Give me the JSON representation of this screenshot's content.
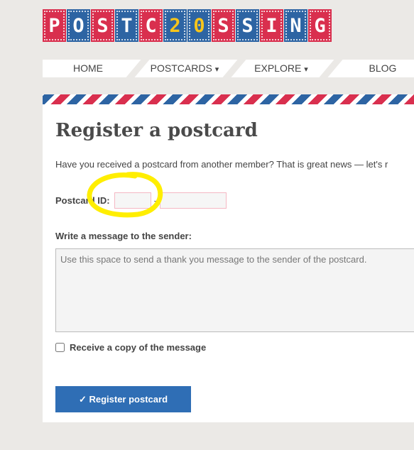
{
  "logo": {
    "letters": [
      "P",
      "O",
      "S",
      "T",
      "C",
      "2",
      "0",
      "S",
      "S",
      "I",
      "N",
      "G"
    ]
  },
  "nav": {
    "items": [
      {
        "label": "HOME"
      },
      {
        "label": "POSTCARDS",
        "caret": "▾"
      },
      {
        "label": "EXPLORE",
        "caret": "▾"
      },
      {
        "label": "BLOG"
      }
    ]
  },
  "page": {
    "title": "Register a postcard",
    "intro": "Have you received a postcard from another member? That is great news — let's r"
  },
  "form": {
    "postcard_id_label": "Postcard ID:",
    "id_separator": "-",
    "id_part1_value": "",
    "id_part2_value": "",
    "message_label": "Write a message to the sender:",
    "message_placeholder": "Use this space to send a thank you message to the sender of the postcard.",
    "copy_label": "Receive a copy of the message",
    "copy_checked": false,
    "submit_label": "✓ Register postcard"
  },
  "colors": {
    "red": "#d92f4e",
    "blue": "#2d64a3",
    "yellow": "#f7c51b",
    "button": "#2f6eb5",
    "marker": "#ffee00"
  }
}
